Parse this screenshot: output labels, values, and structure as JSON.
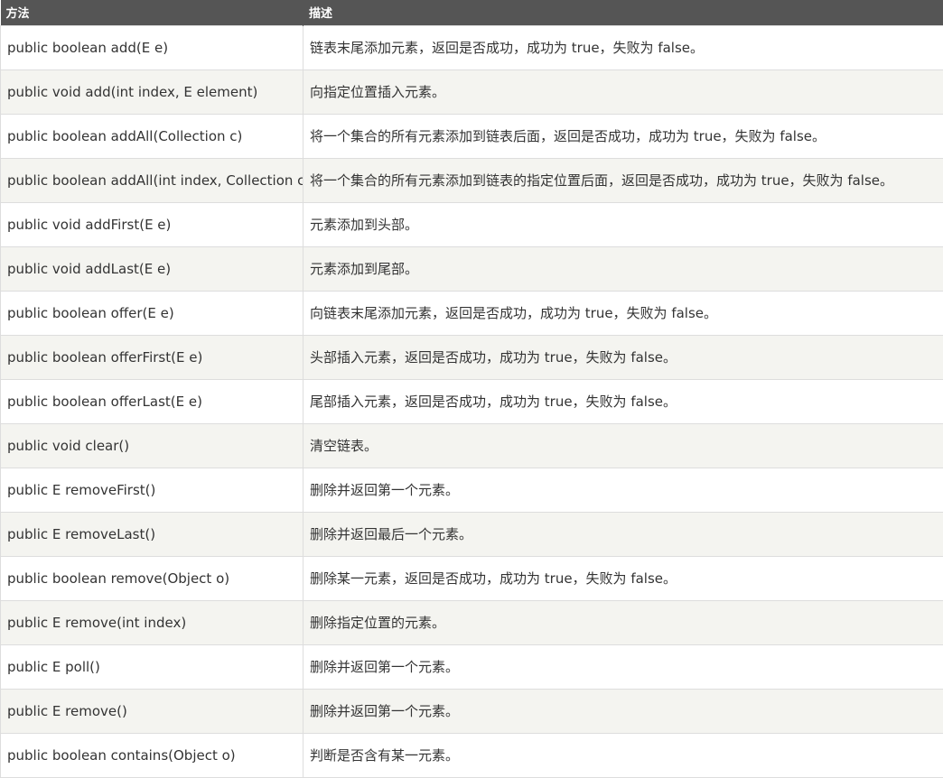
{
  "table": {
    "headers": [
      "方法",
      "描述"
    ],
    "rows": [
      {
        "method": "public boolean add(E e)",
        "desc": "链表末尾添加元素，返回是否成功，成功为 true，失败为 false。"
      },
      {
        "method": "public void add(int index, E element)",
        "desc": "向指定位置插入元素。"
      },
      {
        "method": "public boolean addAll(Collection c)",
        "desc": "将一个集合的所有元素添加到链表后面，返回是否成功，成功为 true，失败为 false。"
      },
      {
        "method": "public boolean addAll(int index, Collection c)",
        "desc": "将一个集合的所有元素添加到链表的指定位置后面，返回是否成功，成功为 true，失败为 false。"
      },
      {
        "method": "public void addFirst(E e)",
        "desc": "元素添加到头部。"
      },
      {
        "method": "public void addLast(E e)",
        "desc": "元素添加到尾部。"
      },
      {
        "method": "public boolean offer(E e)",
        "desc": "向链表末尾添加元素，返回是否成功，成功为 true，失败为 false。"
      },
      {
        "method": "public boolean offerFirst(E e)",
        "desc": "头部插入元素，返回是否成功，成功为 true，失败为 false。"
      },
      {
        "method": "public boolean offerLast(E e)",
        "desc": "尾部插入元素，返回是否成功，成功为 true，失败为 false。"
      },
      {
        "method": "public void clear()",
        "desc": "清空链表。"
      },
      {
        "method": "public E removeFirst()",
        "desc": "删除并返回第一个元素。"
      },
      {
        "method": "public E removeLast()",
        "desc": "删除并返回最后一个元素。"
      },
      {
        "method": "public boolean remove(Object o)",
        "desc": "删除某一元素，返回是否成功，成功为 true，失败为 false。"
      },
      {
        "method": "public E remove(int index)",
        "desc": "删除指定位置的元素。"
      },
      {
        "method": "public E poll()",
        "desc": "删除并返回第一个元素。"
      },
      {
        "method": "public E remove()",
        "desc": "删除并返回第一个元素。"
      },
      {
        "method": "public boolean contains(Object o)",
        "desc": "判断是否含有某一元素。"
      }
    ]
  }
}
